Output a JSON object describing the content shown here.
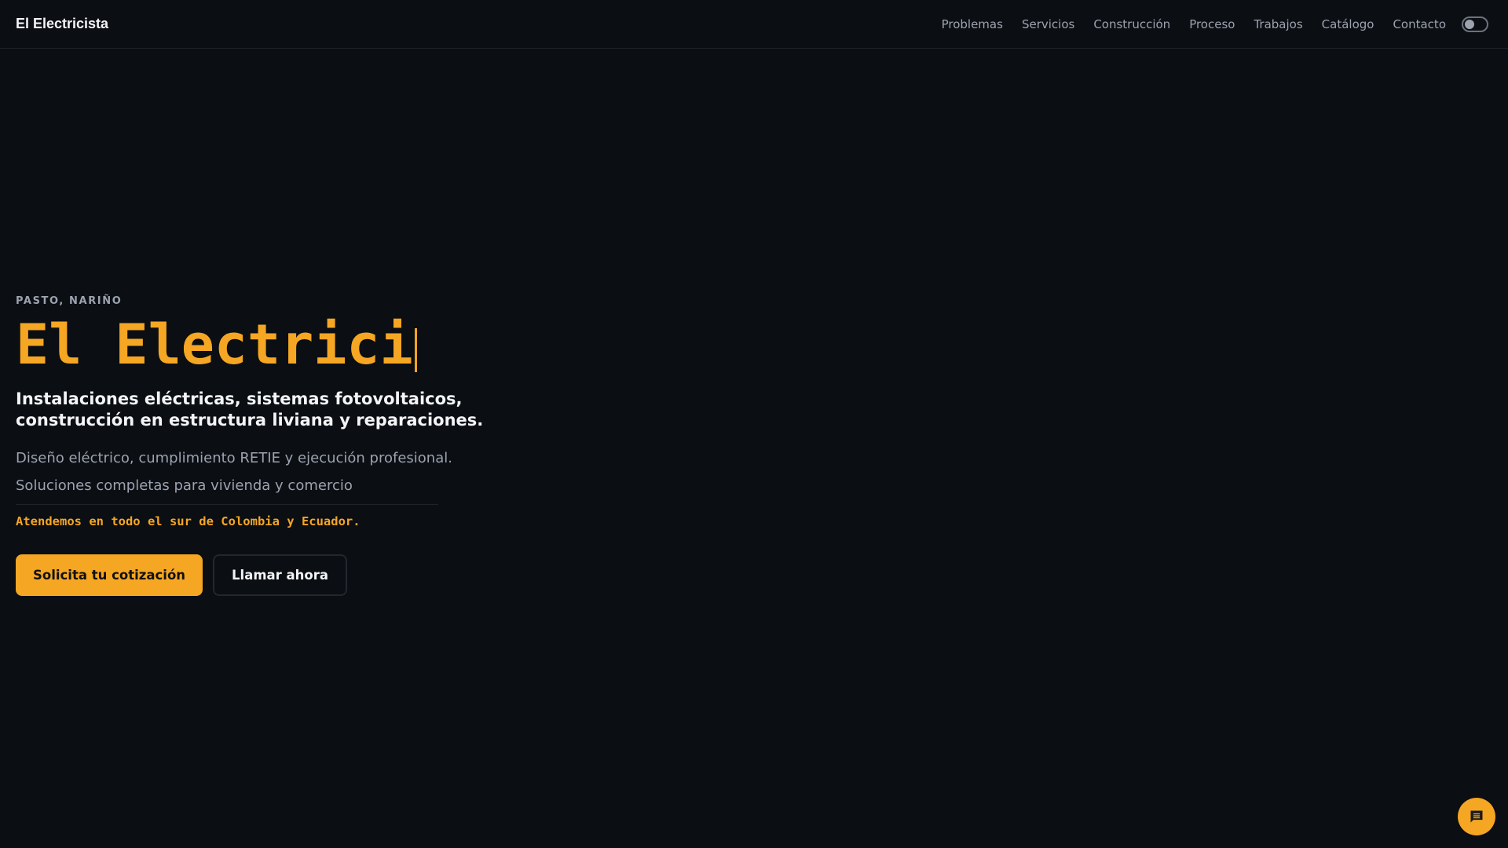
{
  "header": {
    "brand": "El Electricista",
    "nav": [
      "Problemas",
      "Servicios",
      "Construcción",
      "Proceso",
      "Trabajos",
      "Catálogo",
      "Contacto"
    ]
  },
  "hero": {
    "eyebrow": "PASTO, NARIÑO",
    "title": "El Electrici",
    "subtitle": "Instalaciones eléctricas, sistemas fotovoltaicos, construcción en estructura liviana y reparaciones.",
    "desc1": "Diseño eléctrico, cumplimiento RETIE y ejecución profesional.",
    "desc2": "Soluciones completas para vivienda y comercio",
    "coverage": "Atendemos en todo el sur de Colombia y Ecuador.",
    "primary_button": "Solicita tu cotización",
    "secondary_button": "Llamar ahora"
  },
  "colors": {
    "accent": "#f5a623",
    "background": "#0b0e13"
  }
}
